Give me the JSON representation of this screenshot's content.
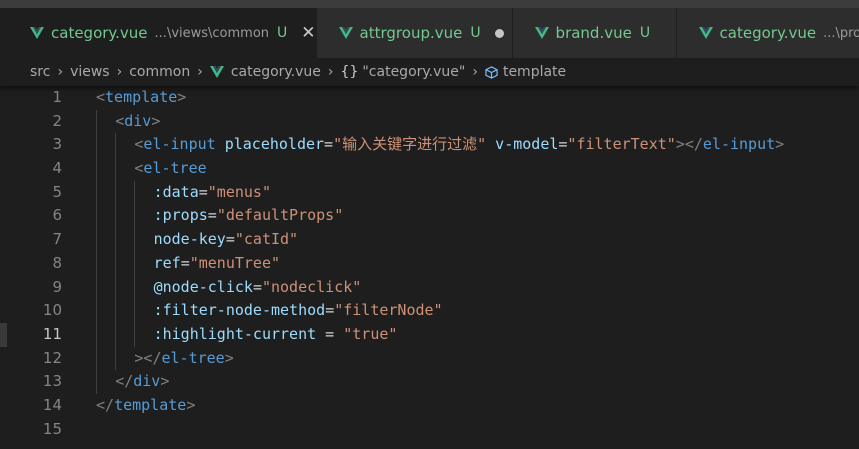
{
  "tabs": [
    {
      "name": "category.vue",
      "path": "...\\views\\common",
      "badge": "U",
      "status": "close",
      "active": true
    },
    {
      "name": "attrgroup.vue",
      "path": "",
      "badge": "U",
      "status": "dot",
      "active": false
    },
    {
      "name": "brand.vue",
      "path": "",
      "badge": "U",
      "status": "",
      "active": false
    },
    {
      "name": "category.vue",
      "path": "...\\produ",
      "badge": "",
      "status": "",
      "active": false
    }
  ],
  "breadcrumb": {
    "items": [
      "src",
      "views",
      "common"
    ],
    "file": "category.vue",
    "braces": "{}",
    "symbol": "\"category.vue\"",
    "last": "template"
  },
  "code_lines": [
    {
      "no": "1",
      "indent": 0,
      "tokens": [
        [
          "tg",
          "<"
        ],
        [
          "tn",
          "template"
        ],
        [
          "tg",
          ">"
        ]
      ]
    },
    {
      "no": "2",
      "indent": 1,
      "tokens": [
        [
          "tg",
          "<"
        ],
        [
          "tn",
          "div"
        ],
        [
          "tg",
          ">"
        ]
      ]
    },
    {
      "no": "3",
      "indent": 2,
      "tokens": [
        [
          "tg",
          "<"
        ],
        [
          "tn",
          "el-input"
        ],
        [
          "eq",
          " "
        ],
        [
          "at",
          "placeholder"
        ],
        [
          "eq",
          "="
        ],
        [
          "st",
          "\"输入关键字进行过滤\""
        ],
        [
          "eq",
          " "
        ],
        [
          "at",
          "v-model"
        ],
        [
          "eq",
          "="
        ],
        [
          "st",
          "\"filterText\""
        ],
        [
          "tg",
          "></"
        ],
        [
          "tn",
          "el-input"
        ],
        [
          "tg",
          ">"
        ]
      ]
    },
    {
      "no": "4",
      "indent": 2,
      "tokens": [
        [
          "tg",
          "<"
        ],
        [
          "tn",
          "el-tree"
        ]
      ]
    },
    {
      "no": "5",
      "indent": 3,
      "tokens": [
        [
          "at",
          ":data"
        ],
        [
          "eq",
          "="
        ],
        [
          "st",
          "\"menus\""
        ]
      ]
    },
    {
      "no": "6",
      "indent": 3,
      "tokens": [
        [
          "at",
          ":props"
        ],
        [
          "eq",
          "="
        ],
        [
          "st",
          "\"defaultProps\""
        ]
      ]
    },
    {
      "no": "7",
      "indent": 3,
      "tokens": [
        [
          "at",
          "node-key"
        ],
        [
          "eq",
          "="
        ],
        [
          "st",
          "\"catId\""
        ]
      ]
    },
    {
      "no": "8",
      "indent": 3,
      "tokens": [
        [
          "at",
          "ref"
        ],
        [
          "eq",
          "="
        ],
        [
          "st",
          "\"menuTree\""
        ]
      ]
    },
    {
      "no": "9",
      "indent": 3,
      "tokens": [
        [
          "at",
          "@node-click"
        ],
        [
          "eq",
          "="
        ],
        [
          "st",
          "\"nodeclick\""
        ]
      ]
    },
    {
      "no": "10",
      "indent": 3,
      "tokens": [
        [
          "at",
          ":filter-node-method"
        ],
        [
          "eq",
          "="
        ],
        [
          "st",
          "\"filterNode\""
        ]
      ]
    },
    {
      "no": "11",
      "indent": 3,
      "tokens": [
        [
          "at",
          ":highlight-current"
        ],
        [
          "eq",
          " = "
        ],
        [
          "st",
          "\"true\""
        ]
      ]
    },
    {
      "no": "12",
      "indent": 2,
      "tokens": [
        [
          "tg",
          "></"
        ],
        [
          "tn",
          "el-tree"
        ],
        [
          "tg",
          ">"
        ]
      ]
    },
    {
      "no": "13",
      "indent": 1,
      "tokens": [
        [
          "tg",
          "</"
        ],
        [
          "tn",
          "div"
        ],
        [
          "tg",
          ">"
        ]
      ]
    },
    {
      "no": "14",
      "indent": 0,
      "tokens": [
        [
          "tg",
          "</"
        ],
        [
          "tn",
          "template"
        ],
        [
          "tg",
          ">"
        ]
      ]
    },
    {
      "no": "15",
      "indent": 0,
      "tokens": []
    }
  ],
  "active_line": "11",
  "colors": {
    "accent_green": "#73c991",
    "vue_icon": "#41b883",
    "tag_bracket": "#808080",
    "tag_name": "#569cd6",
    "attribute": "#9cdcfe",
    "string": "#ce9178"
  },
  "icons": {
    "tab_file": "vue-icon",
    "close": "close-icon",
    "modified": "dot-icon",
    "chevron": "chevron-right-icon",
    "symbol": "cube-icon"
  }
}
